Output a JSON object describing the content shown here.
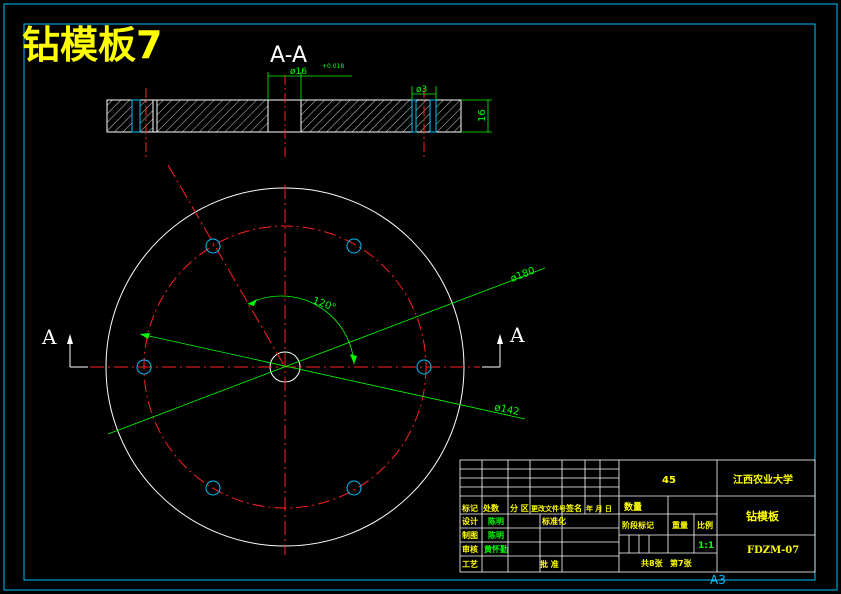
{
  "drawing": {
    "title": "钻模板7",
    "section_label": "A-A",
    "view_marker_left": "A",
    "view_marker_right": "A",
    "sheet_size": "A3"
  },
  "dimensions": {
    "bore_dia": "ø16",
    "bore_tol": "+0.018",
    "hole_dia": "ø3",
    "thickness": "16",
    "angle": "120°",
    "outer_dia": "ø180",
    "pcd_dia": "ø142"
  },
  "title_block": {
    "material": "45",
    "school": "江西农业大学",
    "part_name": "钻模板",
    "drawing_no": "FDZM-07",
    "quantity_label": "数量",
    "stage_mark_label": "阶段标记",
    "weight_label": "重量",
    "scale_label": "比例",
    "scale_value": "1:1",
    "sheet_count": "共8张",
    "sheet_index": "第7张",
    "header_cells": [
      "标记",
      "处数",
      "分 区",
      "更改文件号",
      "签名",
      "年 月 日"
    ],
    "design_label": "设计",
    "design_name": "陈明",
    "standard_label": "标准化",
    "draft_label": "制图",
    "draft_name": "陈明",
    "review_label": "审核",
    "review_name": "黄怀勤",
    "process_label": "工艺",
    "approve_label": "批 准"
  },
  "colors": {
    "frame": "#00bfff",
    "outline": "#ffffff",
    "center_line": "#ff2020",
    "dimension": "#00ff00",
    "title_yellow": "#ffff00",
    "hatch": "#ffffff"
  }
}
